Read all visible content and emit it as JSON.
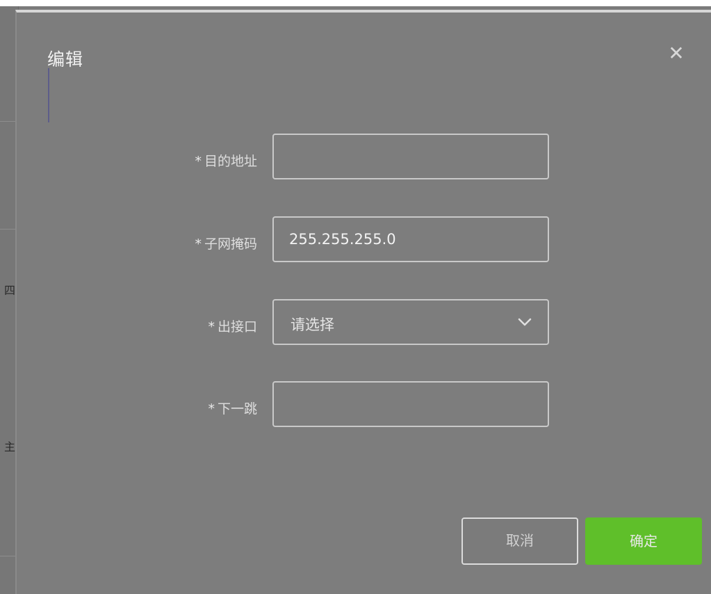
{
  "backdrop": {
    "edge_glyphs": [
      "四",
      "主"
    ]
  },
  "dialog": {
    "title": "编辑",
    "close_glyph": "✕",
    "fields": [
      {
        "label": "目的地址",
        "required_mark": "*",
        "value": "",
        "placeholder": ""
      },
      {
        "label": "子网掩码",
        "required_mark": "*",
        "value": "255.255.255.0",
        "placeholder": ""
      },
      {
        "label": "出接口",
        "required_mark": "*",
        "value": "请选择",
        "icon": "chevron-down-icon"
      },
      {
        "label": "下一跳",
        "required_mark": "*",
        "value": "",
        "placeholder": ""
      }
    ],
    "buttons": {
      "cancel": "取消",
      "confirm": "确定"
    }
  },
  "colors": {
    "accent_green": "#5fbf2a",
    "overlay_gray": "#7b7b7b",
    "border_light": "#c9c9c9"
  }
}
